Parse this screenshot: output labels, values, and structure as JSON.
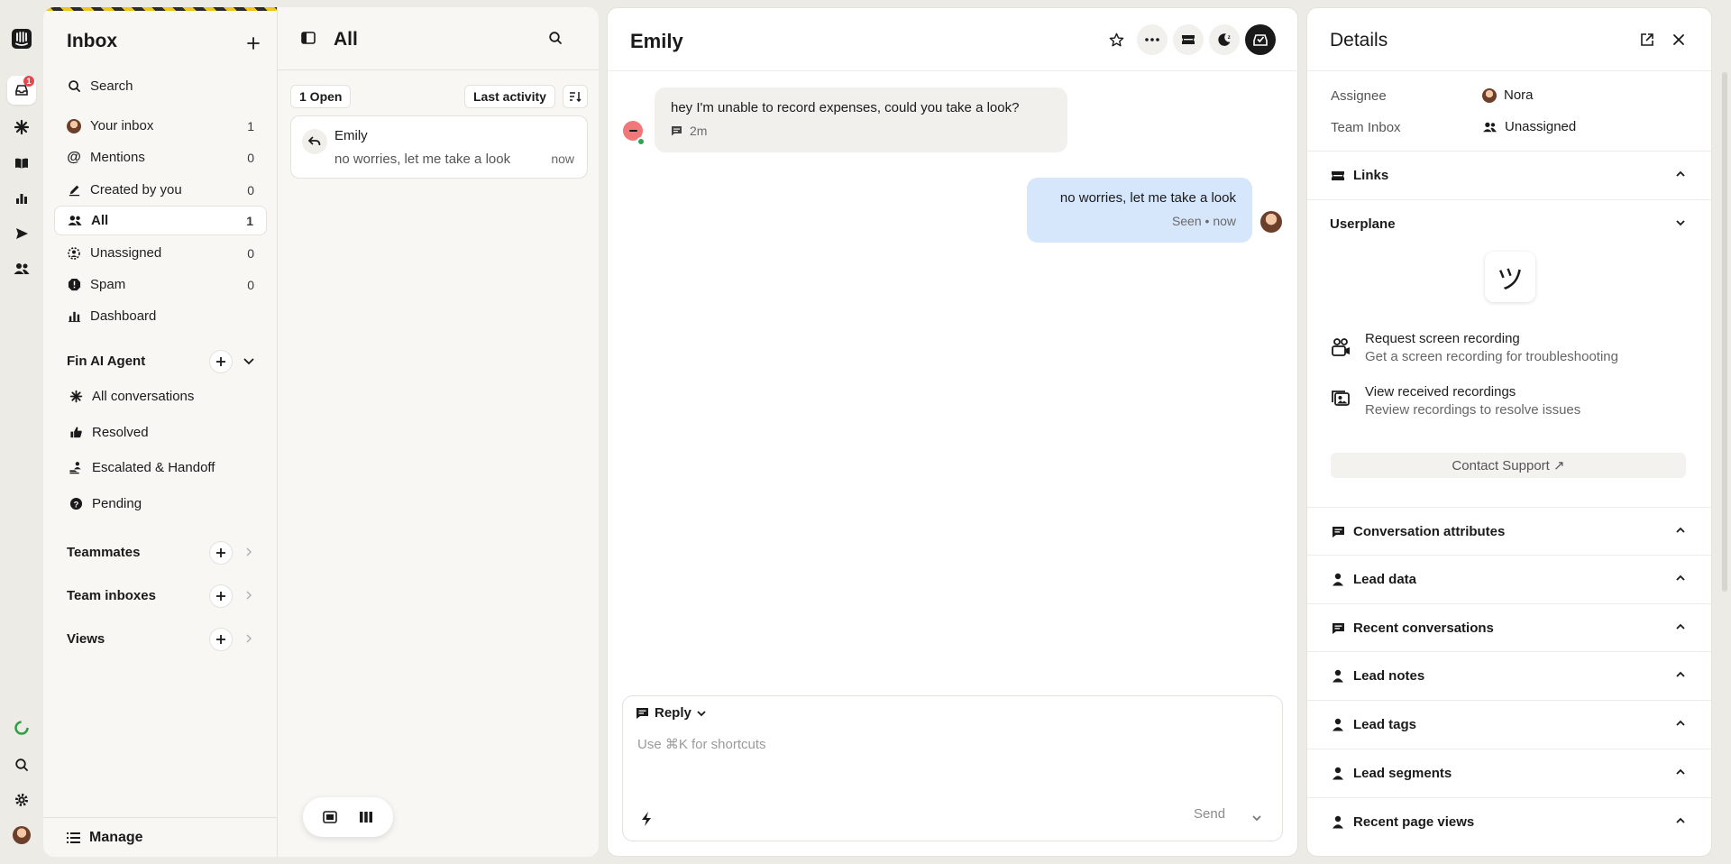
{
  "rail": {
    "inbox_badge": "1"
  },
  "nav": {
    "title": "Inbox",
    "search": "Search",
    "items": [
      {
        "label": "Your inbox",
        "count": "1"
      },
      {
        "label": "Mentions",
        "count": "0"
      },
      {
        "label": "Created by you",
        "count": "0"
      },
      {
        "label": "All",
        "count": "1"
      },
      {
        "label": "Unassigned",
        "count": "0"
      },
      {
        "label": "Spam",
        "count": "0"
      },
      {
        "label": "Dashboard",
        "count": ""
      }
    ],
    "fin_title": "Fin AI Agent",
    "fin_items": [
      "All conversations",
      "Resolved",
      "Escalated & Handoff",
      "Pending"
    ],
    "teammates": "Teammates",
    "team_inboxes": "Team inboxes",
    "views": "Views",
    "manage": "Manage"
  },
  "list": {
    "title": "All",
    "open_filter": "1 Open",
    "sort": "Last activity",
    "conversation": {
      "name": "Emily",
      "preview": "no worries, let me take a look",
      "time": "now"
    }
  },
  "chat": {
    "title": "Emily",
    "incoming": {
      "text": "hey I'm unable to record expenses, could you take a look?",
      "time": "2m"
    },
    "outgoing": {
      "text": "no worries, let me take a look",
      "status": "Seen • now"
    },
    "composer": {
      "mode": "Reply",
      "placeholder": "Use ⌘K for shortcuts",
      "send": "Send"
    }
  },
  "details": {
    "title": "Details",
    "assignee_label": "Assignee",
    "assignee_value": "Nora",
    "team_label": "Team Inbox",
    "team_value": "Unassigned",
    "links": "Links",
    "userplane": "Userplane",
    "userplane_logo": "ツ",
    "actions": [
      {
        "title": "Request screen recording",
        "subtitle": "Get a screen recording for troubleshooting"
      },
      {
        "title": "View received recordings",
        "subtitle": "Review recordings to resolve issues"
      }
    ],
    "contact_support": "Contact Support ↗",
    "sections": [
      "Conversation attributes",
      "Lead data",
      "Recent conversations",
      "Lead notes",
      "Lead tags",
      "Lead segments",
      "Recent page views"
    ]
  }
}
